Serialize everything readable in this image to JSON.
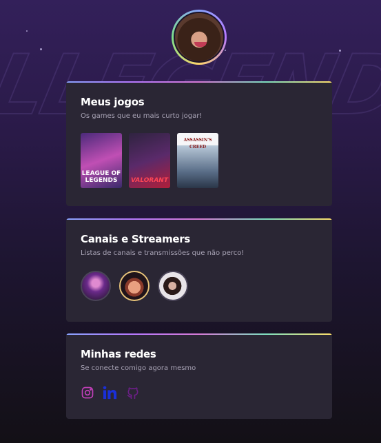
{
  "games_card": {
    "title": "Meus jogos",
    "subtitle": "Os games que eu mais curto jogar!",
    "games": [
      {
        "label": "LEAGUE OF LEGENDS"
      },
      {
        "label": "VALORANT"
      },
      {
        "label": "ASSASSIN'S CREED"
      }
    ]
  },
  "channels_card": {
    "title": "Canais e Streamers",
    "subtitle": "Listas de canais e transmissões que não perco!"
  },
  "socials_card": {
    "title": "Minhas redes",
    "subtitle": "Se conecte comigo agora mesmo",
    "icons": [
      "instagram-icon",
      "linkedin-icon",
      "github-icon"
    ]
  },
  "colors": {
    "instagram": "#c13fb8",
    "linkedin": "#1a2fd8",
    "github": "#6b1f86"
  }
}
